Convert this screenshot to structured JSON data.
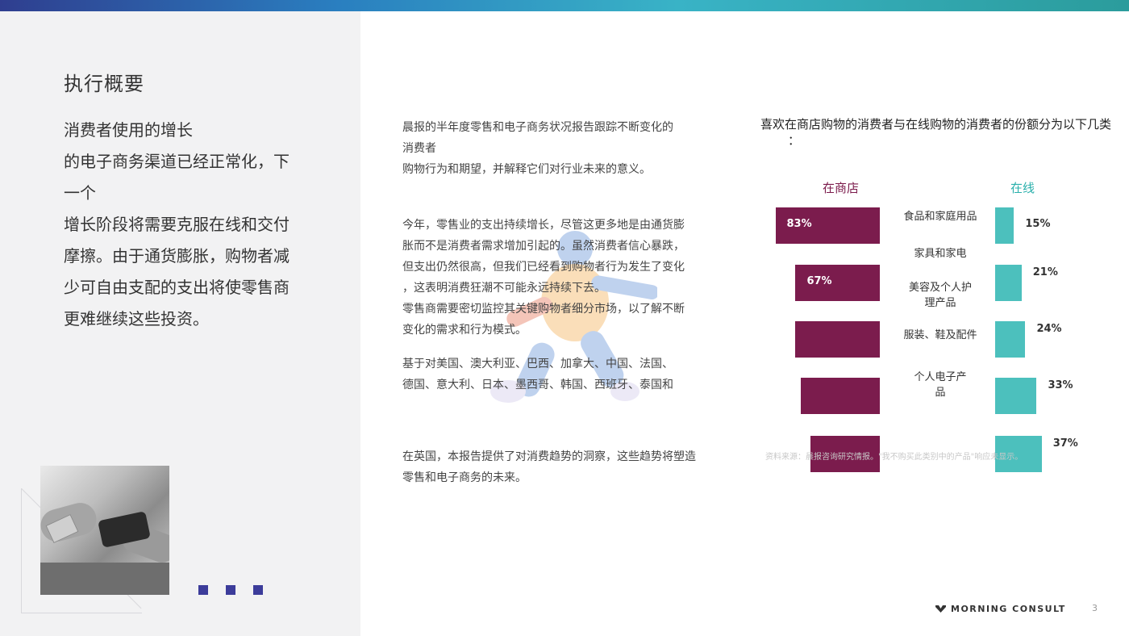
{
  "left": {
    "title": "执行概要",
    "body_lines": [
      "消费者使用的增长",
      "的电子商务渠道已经正常化，下",
      "一个",
      "增长阶段将需要克服在线和交付",
      "摩擦。由于通货膨胀，购物者减",
      "少可自由支配的支出将使零售商",
      "更难继续这些投资。"
    ]
  },
  "middle": {
    "p1": [
      "晨报的半年度零售和电子商务状况报告跟踪不断变化的",
      "消费者",
      "购物行为和期望，并解释它们对行业未来的意义。"
    ],
    "p2": [
      "今年，零售业的支出持续增长，尽管这更多地是由通货膨",
      "胀而不是消费者需求增加引起的。虽然消费者信心暴跌，",
      "但支出仍然很高，但我们已经看到购物者行为发生了变化",
      "，这表明消费狂潮不可能永远持续下去。",
      "零售商需要密切监控其关键购物者细分市场，以了解不断",
      "变化的需求和行为模式。"
    ],
    "p3": [
      "基于对美国、澳大利亚、巴西、加拿大、中国、法国、",
      "德国、意大利、日本、墨西哥、韩国、西班牙、泰国和"
    ],
    "p4": [
      "在英国，本报告提供了对消费趋势的洞察，这些趋势将塑造",
      "零售和电子商务的未来。"
    ]
  },
  "chart_data": {
    "type": "bar",
    "title": "喜欢在商店购物的消费者与在线购物的消费者的份额分为以下几类",
    "title_tail": "：",
    "series": [
      {
        "name": "在商店",
        "color": "#7b1c4d",
        "values": [
          83,
          67,
          null,
          null,
          null
        ],
        "labels": [
          "83%",
          "67%",
          "",
          "",
          ""
        ]
      },
      {
        "name": "在线",
        "color": "#4cc0bd",
        "values": [
          15,
          21,
          24,
          33,
          37
        ],
        "labels": [
          "15%",
          "21%",
          "24%",
          "33%",
          "37%"
        ]
      }
    ],
    "categories": [
      "食品和家庭用品",
      "家具和家电",
      "美容及个人护理产品",
      "服装、鞋及配件",
      "个人电子产品"
    ],
    "source": "资料来源：晨报咨询研究情报。\"我不购买此类别中的产品\"响应未显示。"
  },
  "footer": {
    "brand": "MORNING CONSULT",
    "page_number": "3"
  },
  "colors": {
    "store": "#7b1c4d",
    "online": "#4cc0bd",
    "dots": "#3c3c9a"
  }
}
